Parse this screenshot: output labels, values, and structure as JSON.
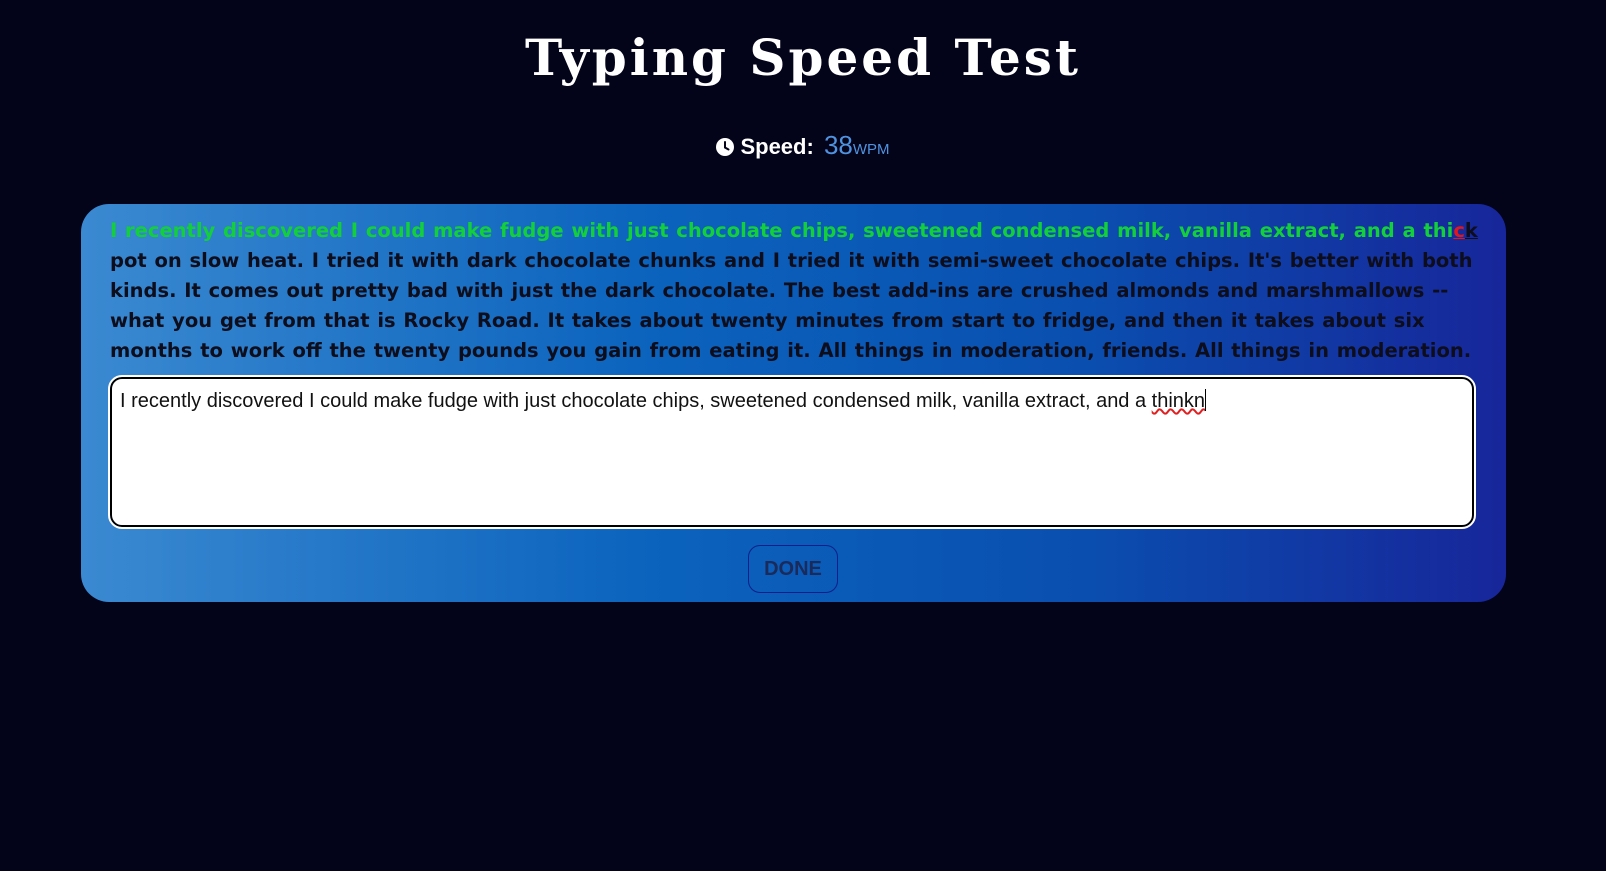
{
  "header": {
    "title": "Typing Speed Test"
  },
  "speed": {
    "icon": "clock-icon",
    "label": "Speed:",
    "value": "38",
    "unit": "WPM"
  },
  "passage": {
    "typed_correct": "I recently discovered I could make fudge with just chocolate chips, sweetened condensed milk, vanilla extract, and a thi",
    "error_char": "c",
    "current_chars": "k ",
    "remaining": "pot on slow heat. I tried it with dark chocolate chunks and I tried it with semi-sweet chocolate chips. It's better with both kinds. It comes out pretty bad with just the dark chocolate. The best add-ins are crushed almonds and marshmallows -- what you get from that is Rocky Road. It takes about twenty minutes from start to fridge, and then it takes about six months to work off the twenty pounds you gain from eating it. All things in moderation, friends. All things in moderation."
  },
  "input": {
    "value_prefix": "I recently discovered I could make fudge with just chocolate chips, sweetened condensed milk, vanilla extract, and a ",
    "value_misspelled": "thinkn"
  },
  "actions": {
    "done_label": "DONE"
  },
  "colors": {
    "background": "#03031a",
    "typed_correct": "#13d03a",
    "error": "#e0171f",
    "speed_value": "#4f93e0"
  }
}
